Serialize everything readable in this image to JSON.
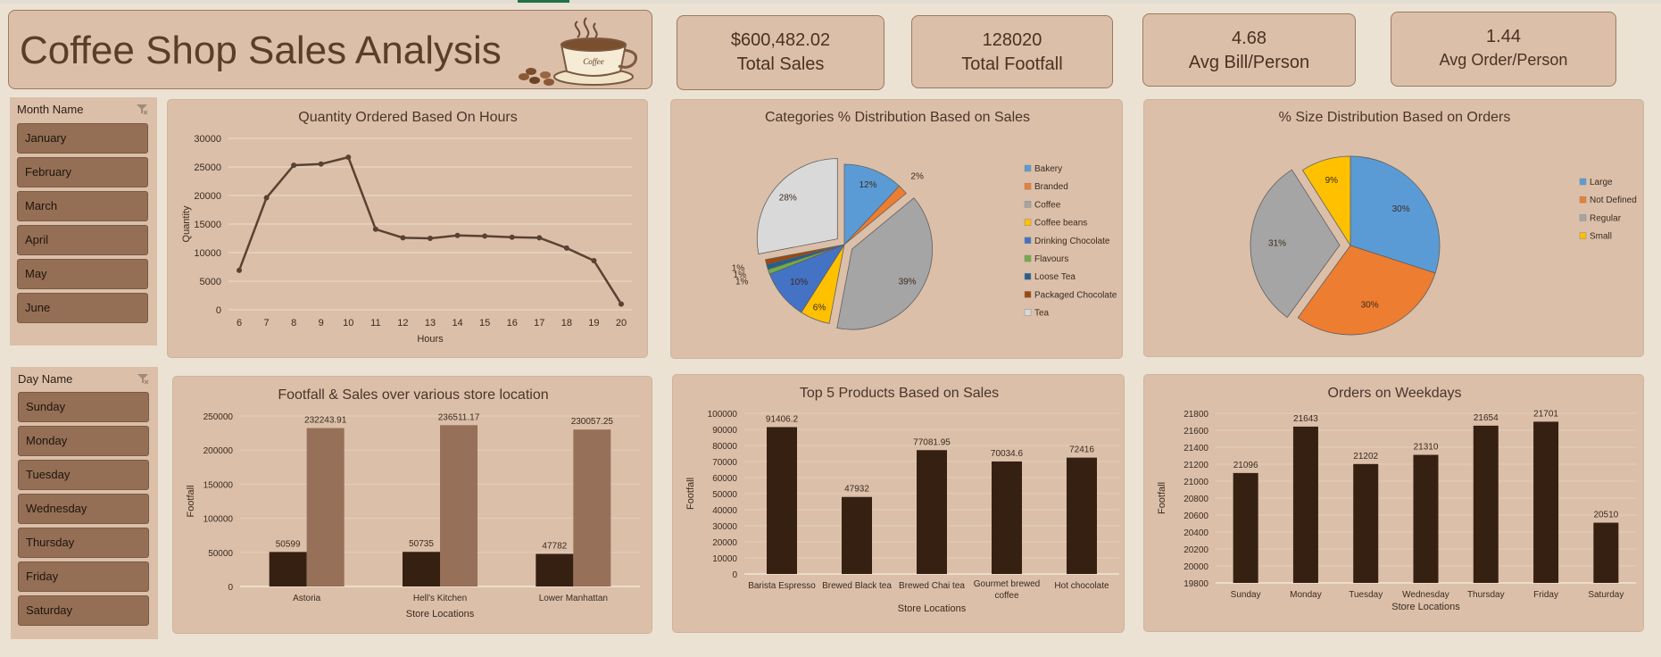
{
  "dashboard": {
    "title": "Coffee Shop Sales Analysis",
    "cup_label": "Coffee"
  },
  "kpis": [
    {
      "value": "$600,482.02",
      "label": "Total Sales"
    },
    {
      "value": "128020",
      "label": "Total Footfall"
    },
    {
      "value": "4.68",
      "label": "Avg Bill/Person"
    },
    {
      "value": "1.44",
      "label": "Avg Order/Person"
    }
  ],
  "slicers": {
    "month": {
      "header": "Month Name",
      "items": [
        "January",
        "February",
        "March",
        "April",
        "May",
        "June"
      ]
    },
    "day": {
      "header": "Day Name",
      "items": [
        "Sunday",
        "Monday",
        "Tuesday",
        "Wednesday",
        "Thursday",
        "Friday",
        "Saturday"
      ]
    }
  },
  "colors": {
    "background": "#ebe2d3",
    "panel": "#dbbfa9",
    "dark_bar": "#362012",
    "light_bar": "#967058",
    "line": "#5a4232"
  },
  "chart_data": [
    {
      "type": "line",
      "title": "Quantity Ordered Based On Hours",
      "xlabel": "Hours",
      "ylabel": "Quantity",
      "x": [
        6,
        7,
        8,
        9,
        10,
        11,
        12,
        13,
        14,
        15,
        16,
        17,
        18,
        19,
        20
      ],
      "values": [
        6900,
        19600,
        25300,
        25500,
        26700,
        14100,
        12600,
        12500,
        13000,
        12900,
        12700,
        12600,
        10800,
        8600,
        1000
      ],
      "ylim": [
        0,
        30000
      ],
      "yticks": [
        "0",
        "5000",
        "10000",
        "15000",
        "20000",
        "25000",
        "30000"
      ],
      "grid": true
    },
    {
      "type": "pie",
      "title": "Categories % Distribution Based on Sales",
      "categories": [
        "Bakery",
        "Branded",
        "Coffee",
        "Coffee beans",
        "Drinking Chocolate",
        "Flavours",
        "Loose Tea",
        "Packaged Chocolate",
        "Tea"
      ],
      "values": [
        12,
        2,
        39,
        6,
        10,
        1,
        1,
        1,
        28
      ],
      "labels": [
        "12%",
        "2%",
        "39%",
        "6%",
        "10%",
        "1%",
        "1%",
        "1%",
        "28%"
      ],
      "colors": [
        "#5b9bd5",
        "#ed7d31",
        "#a5a5a5",
        "#ffc000",
        "#4472c4",
        "#70ad47",
        "#255e91",
        "#9e480e",
        "#d9d9d9"
      ],
      "legend": "right"
    },
    {
      "type": "pie",
      "title": "% Size Distribution Based on Orders",
      "categories": [
        "Large",
        "Not Defined",
        "Regular",
        "Small"
      ],
      "values": [
        30,
        30,
        31,
        9
      ],
      "labels": [
        "30%",
        "30%",
        "31%",
        "9%"
      ],
      "colors": [
        "#5b9bd5",
        "#ed7d31",
        "#a5a5a5",
        "#ffc000"
      ],
      "legend": "right"
    },
    {
      "type": "bar",
      "title": "Footfall & Sales over various store location",
      "xlabel": "Store Locations",
      "ylabel": "Footfall",
      "categories": [
        "Astoria",
        "Hell's Kitchen",
        "Lower Manhattan"
      ],
      "series": [
        {
          "values": [
            50599,
            50735,
            47782
          ],
          "labels": [
            "50599",
            "50735",
            "47782"
          ]
        },
        {
          "values": [
            232243.91,
            236511.17,
            230057.25
          ],
          "labels": [
            "232243.91",
            "236511.17",
            "230057.25"
          ]
        }
      ],
      "ylim": [
        0,
        250000
      ],
      "yticks": [
        "0",
        "50000",
        "100000",
        "150000",
        "200000",
        "250000"
      ],
      "grid": true
    },
    {
      "type": "bar",
      "title": "Top 5 Products Based on Sales",
      "xlabel": "Store Locations",
      "ylabel": "Footfall",
      "categories": [
        "Barista Espresso",
        "Brewed Black tea",
        "Brewed Chai tea",
        "Gourmet brewed coffee",
        "Hot chocolate"
      ],
      "values": [
        91406.2,
        47932,
        77081.95,
        70034.6,
        72416
      ],
      "labels": [
        "91406.2",
        "47932",
        "77081.95",
        "70034.6",
        "72416"
      ],
      "ylim": [
        0,
        100000
      ],
      "yticks": [
        "0",
        "10000",
        "20000",
        "30000",
        "40000",
        "50000",
        "60000",
        "70000",
        "80000",
        "90000",
        "100000"
      ],
      "grid": true
    },
    {
      "type": "bar",
      "title": "Orders on Weekdays",
      "xlabel": "Store Locations",
      "ylabel": "Footfall",
      "categories": [
        "Sunday",
        "Monday",
        "Tuesday",
        "Wednesday",
        "Thursday",
        "Friday",
        "Saturday"
      ],
      "values": [
        21096,
        21643,
        21202,
        21310,
        21654,
        21701,
        20510
      ],
      "labels": [
        "21096",
        "21643",
        "21202",
        "21310",
        "21654",
        "21701",
        "20510"
      ],
      "ylim": [
        19800,
        21800
      ],
      "yticks": [
        "19800",
        "20000",
        "20200",
        "20400",
        "20600",
        "20800",
        "21000",
        "21200",
        "21400",
        "21600",
        "21800"
      ],
      "grid": true
    }
  ]
}
